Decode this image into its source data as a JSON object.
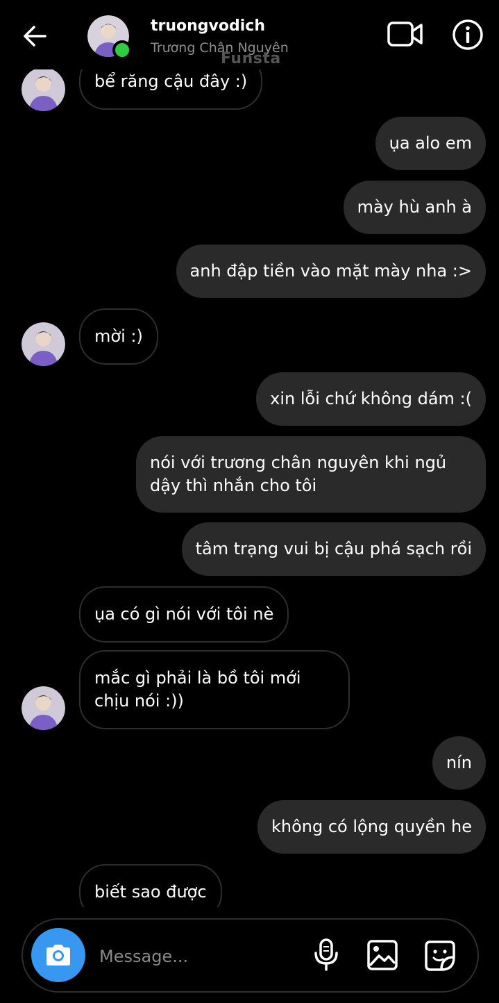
{
  "header": {
    "username": "truongvodich",
    "subtitle": "Trương Chân Nguyên",
    "watermark": "Funsta",
    "icons": {
      "back": "back-arrow-icon",
      "video": "video-call-icon",
      "info": "info-icon"
    },
    "online": true
  },
  "messages": [
    {
      "sender": "them",
      "text": "bể răng cậu đây :)",
      "show_avatar": true
    },
    {
      "sender": "me",
      "text": "ụa alo em"
    },
    {
      "sender": "me",
      "text": "mày hù anh à"
    },
    {
      "sender": "me",
      "text": "anh đập tiền vào mặt mày nha :>"
    },
    {
      "sender": "them",
      "text": "mời :)",
      "show_avatar": true
    },
    {
      "sender": "me",
      "text": "xin lỗi chứ không dám :("
    },
    {
      "sender": "me",
      "text": "nói với trương chân nguyên khi ngủ dậy thì nhắn cho tôi"
    },
    {
      "sender": "me",
      "text": "tâm trạng vui bị cậu phá sạch rồi"
    },
    {
      "sender": "them",
      "text": "ụa có gì nói với tôi nè",
      "show_avatar": false
    },
    {
      "sender": "them",
      "text": "mắc gì phải là bồ tôi mới chịu nói :))",
      "show_avatar": true
    },
    {
      "sender": "me",
      "text": "nín"
    },
    {
      "sender": "me",
      "text": "không có lộng quyền he"
    },
    {
      "sender": "them",
      "text": "biết sao được",
      "show_avatar": false
    }
  ],
  "composer": {
    "placeholder": "Message...",
    "icons": {
      "camera": "camera-icon",
      "mic": "microphone-icon",
      "gallery": "gallery-icon",
      "sticker": "sticker-icon"
    }
  },
  "colors": {
    "background": "#000000",
    "outgoing_bubble": "#2a2a2a",
    "incoming_border": "#2e2e2e",
    "camera_button": "#3897f0",
    "online_dot": "#2ecc40",
    "secondary_text": "#8e8e8e"
  }
}
